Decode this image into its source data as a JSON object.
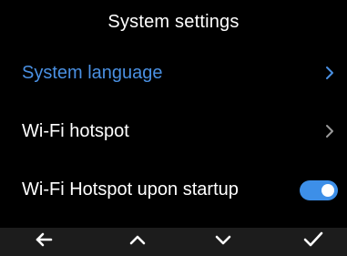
{
  "header": {
    "title": "System settings"
  },
  "menu": {
    "items": [
      {
        "label": "System language",
        "selected": true,
        "control": "chevron-right-icon"
      },
      {
        "label": "Wi-Fi hotspot",
        "selected": false,
        "control": "chevron-right-icon"
      },
      {
        "label": "Wi-Fi Hotspot upon startup",
        "selected": false,
        "control": "toggle-switch",
        "toggle_on": true
      }
    ]
  },
  "footer": {
    "buttons": [
      {
        "icon": "arrow-left-icon"
      },
      {
        "icon": "chevron-up-icon"
      },
      {
        "icon": "chevron-down-icon"
      },
      {
        "icon": "checkmark-icon"
      }
    ]
  },
  "colors": {
    "background": "#000000",
    "text": "#ffffff",
    "selected_text": "#4a90e2",
    "toggle_on": "#3d8fe8",
    "footer_bar": "#1c1c1c",
    "chevron": "#9a9a9a"
  }
}
